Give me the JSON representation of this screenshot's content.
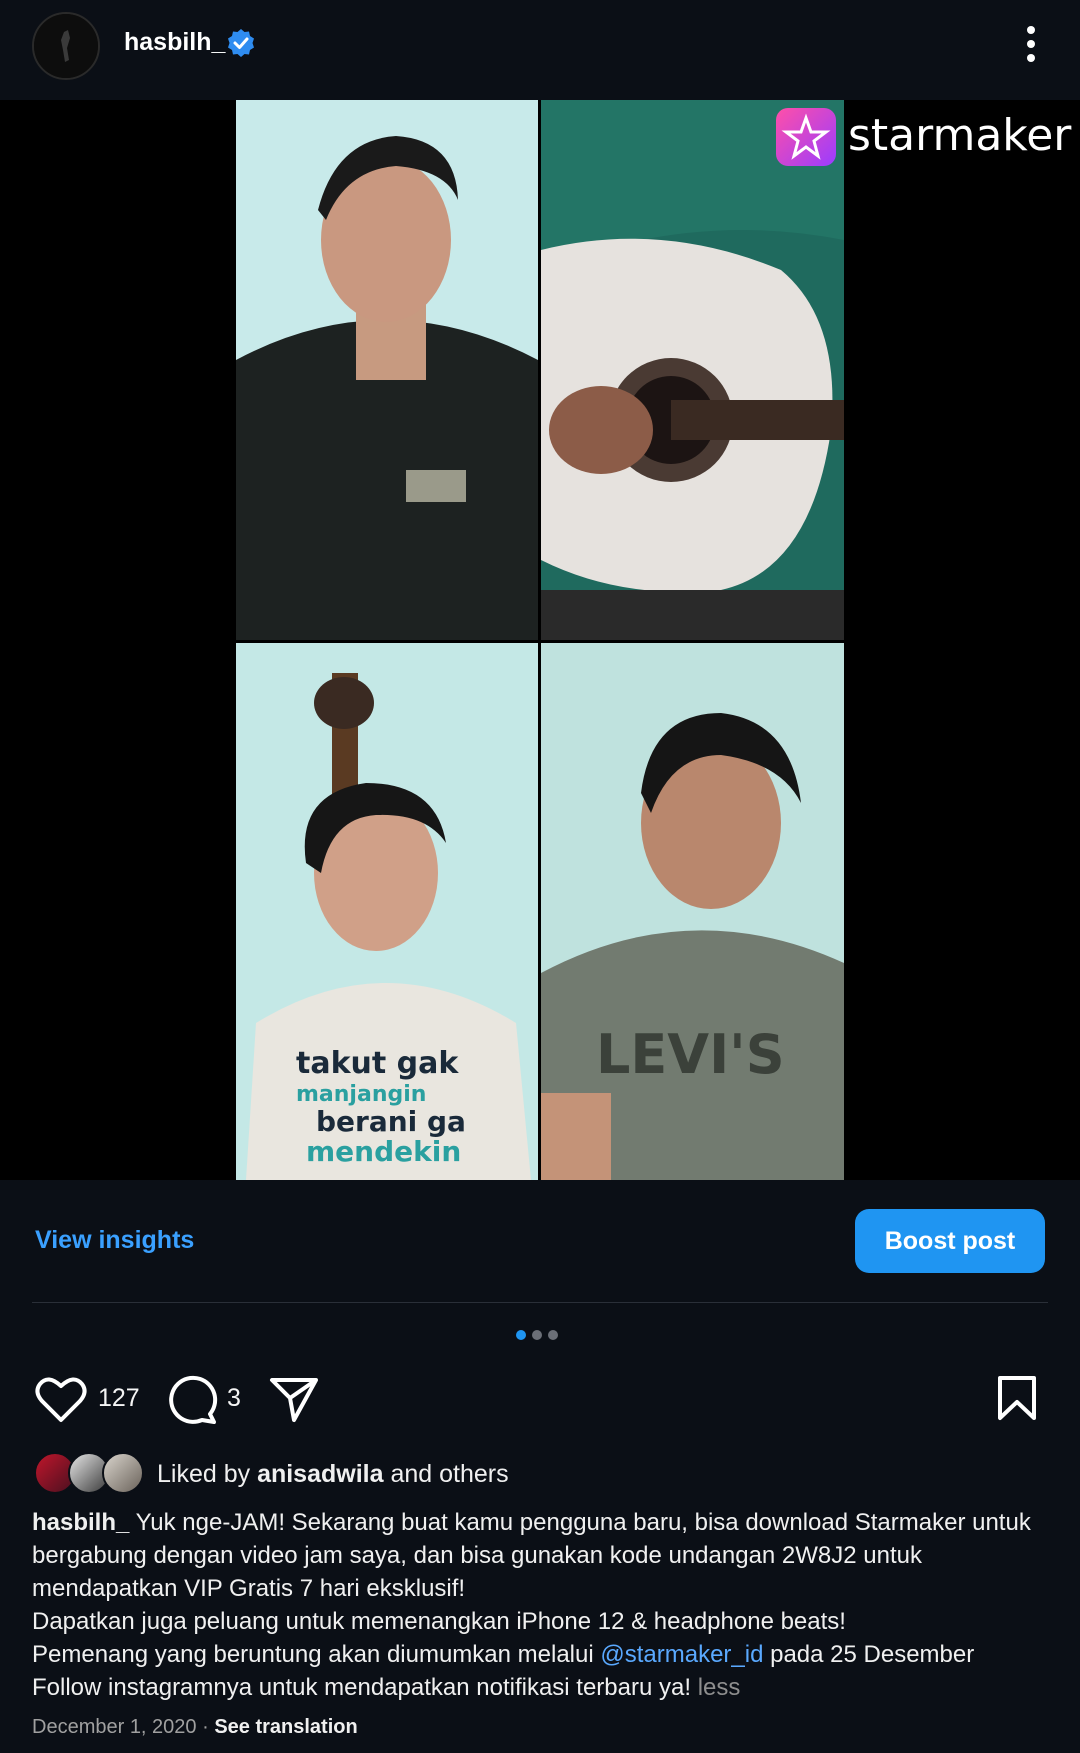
{
  "header": {
    "username": "hasbilh_",
    "verified_icon": "verified-badge-icon",
    "more_icon": "more-vertical-icon"
  },
  "media": {
    "watermark": "starmaker",
    "carousel_count": 3,
    "carousel_active": 1
  },
  "insights": {
    "view_insights_label": "View insights",
    "boost_label": "Boost post"
  },
  "actions": {
    "likes": "127",
    "comments": "3"
  },
  "likes": {
    "prefix": "Liked by ",
    "user": "anisadwila",
    "suffix": " and others"
  },
  "caption": {
    "user": "hasbilh_",
    "part1": " Yuk nge-JAM! Sekarang buat kamu  pengguna baru, bisa download Starmaker untuk bergabung dengan video jam saya, dan bisa gunakan kode undangan 2W8J2 untuk mendapatkan VIP Gratis 7 hari eksklusif!",
    "line2": "Dapatkan juga peluang untuk memenangkan iPhone 12 & headphone beats!",
    "line3_pre": "Pemenang yang beruntung akan diumumkan melalui ",
    "mention": "@starmaker_id",
    "line3_post": " pada 25 Desember",
    "line4": "Follow instagramnya untuk mendapatkan notifikasi terbaru ya! ",
    "less": "less"
  },
  "meta": {
    "date": "December 1, 2020",
    "separator": " · ",
    "translation": "See translation"
  },
  "colors": {
    "background": "#0b0f16",
    "accent": "#1f95f2",
    "link": "#3aa0ff"
  }
}
